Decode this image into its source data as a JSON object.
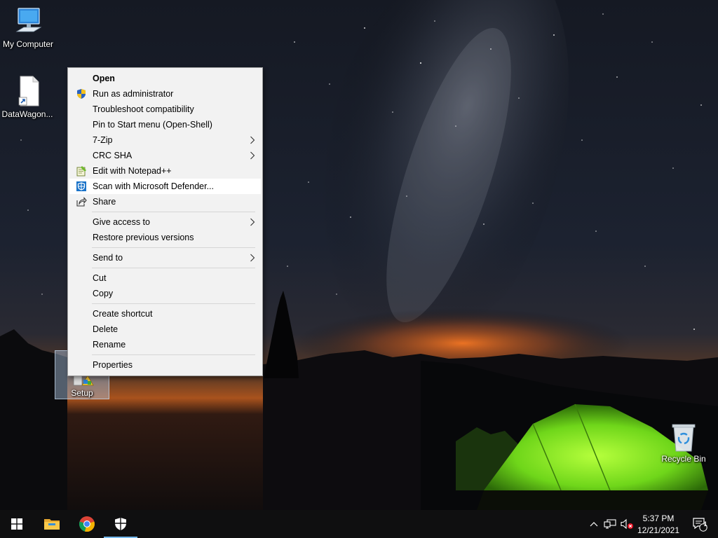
{
  "desktop": {
    "icons": [
      {
        "label": "My Computer",
        "icon": "computer-icon"
      },
      {
        "label": "DataWagon...",
        "icon": "file-shortcut-icon"
      },
      {
        "label": "Setup",
        "icon": "setup-icon"
      },
      {
        "label": "Recycle Bin",
        "icon": "recycle-bin-icon"
      }
    ]
  },
  "context_menu": {
    "items": {
      "open": "Open",
      "run_as_admin": "Run as administrator",
      "troubleshoot": "Troubleshoot compatibility",
      "pin_start": "Pin to Start menu (Open-Shell)",
      "zip": "7-Zip",
      "crc": "CRC SHA",
      "notepad": "Edit with Notepad++",
      "defender": "Scan with Microsoft Defender...",
      "share": "Share",
      "give_access": "Give access to",
      "restore": "Restore previous versions",
      "send_to": "Send to",
      "cut": "Cut",
      "copy": "Copy",
      "create_shortcut": "Create shortcut",
      "delete": "Delete",
      "rename": "Rename",
      "properties": "Properties"
    },
    "highlighted": "Scan with Microsoft Defender..."
  },
  "taskbar": {
    "pinned": [
      "start-icon",
      "file-explorer-icon",
      "chrome-icon",
      "defender-shield-icon"
    ],
    "tray": [
      "chevron-up-icon",
      "network-icon",
      "volume-muted-icon"
    ],
    "clock": {
      "time": "5:37 PM",
      "date": "12/21/2021"
    },
    "notification_count": "1",
    "accent": "#76b9ed"
  }
}
